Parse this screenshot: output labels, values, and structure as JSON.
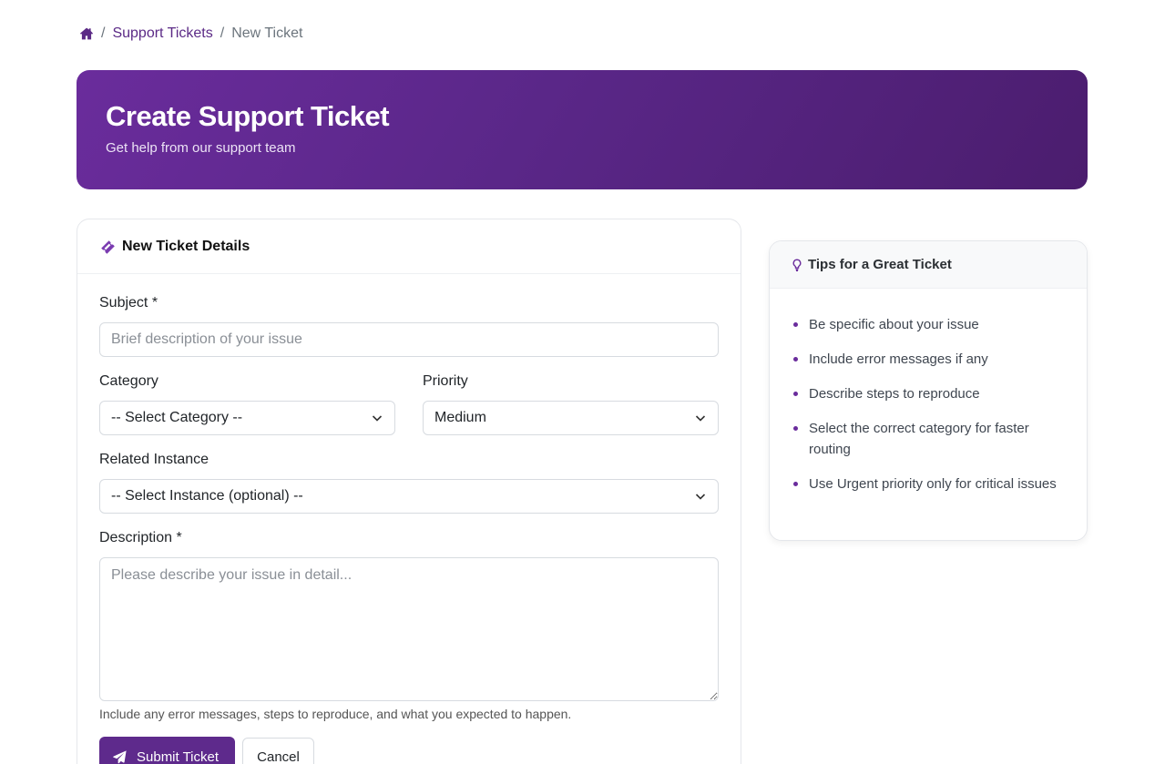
{
  "breadcrumb": {
    "home_icon": "home-icon",
    "parent": "Support Tickets",
    "current": "New Ticket",
    "separator": "/"
  },
  "hero": {
    "title": "Create Support Ticket",
    "subtitle": "Get help from our support team"
  },
  "form": {
    "header_icon": "ticket-icon",
    "header_title": "New Ticket Details",
    "subject": {
      "label": "Subject *",
      "placeholder": "Brief description of your issue",
      "value": ""
    },
    "category": {
      "label": "Category",
      "selected": "-- Select Category --"
    },
    "priority": {
      "label": "Priority",
      "selected": "Medium"
    },
    "instance": {
      "label": "Related Instance",
      "selected": "-- Select Instance (optional) --"
    },
    "description": {
      "label": "Description *",
      "placeholder": "Please describe your issue in detail...",
      "value": "",
      "help": "Include any error messages, steps to reproduce, and what you expected to happen."
    },
    "submit_label": "Submit Ticket",
    "cancel_label": "Cancel"
  },
  "tips": {
    "header_icon": "lightbulb-icon",
    "title": "Tips for a Great Ticket",
    "items": [
      "Be specific about your issue",
      "Include error messages if any",
      "Describe steps to reproduce",
      "Select the correct category for faster routing",
      "Use Urgent priority only for critical issues"
    ]
  },
  "colors": {
    "accent": "#5e2a8c",
    "hero_gradient_start": "#6a2c9c",
    "hero_gradient_end": "#4b1d6e"
  }
}
